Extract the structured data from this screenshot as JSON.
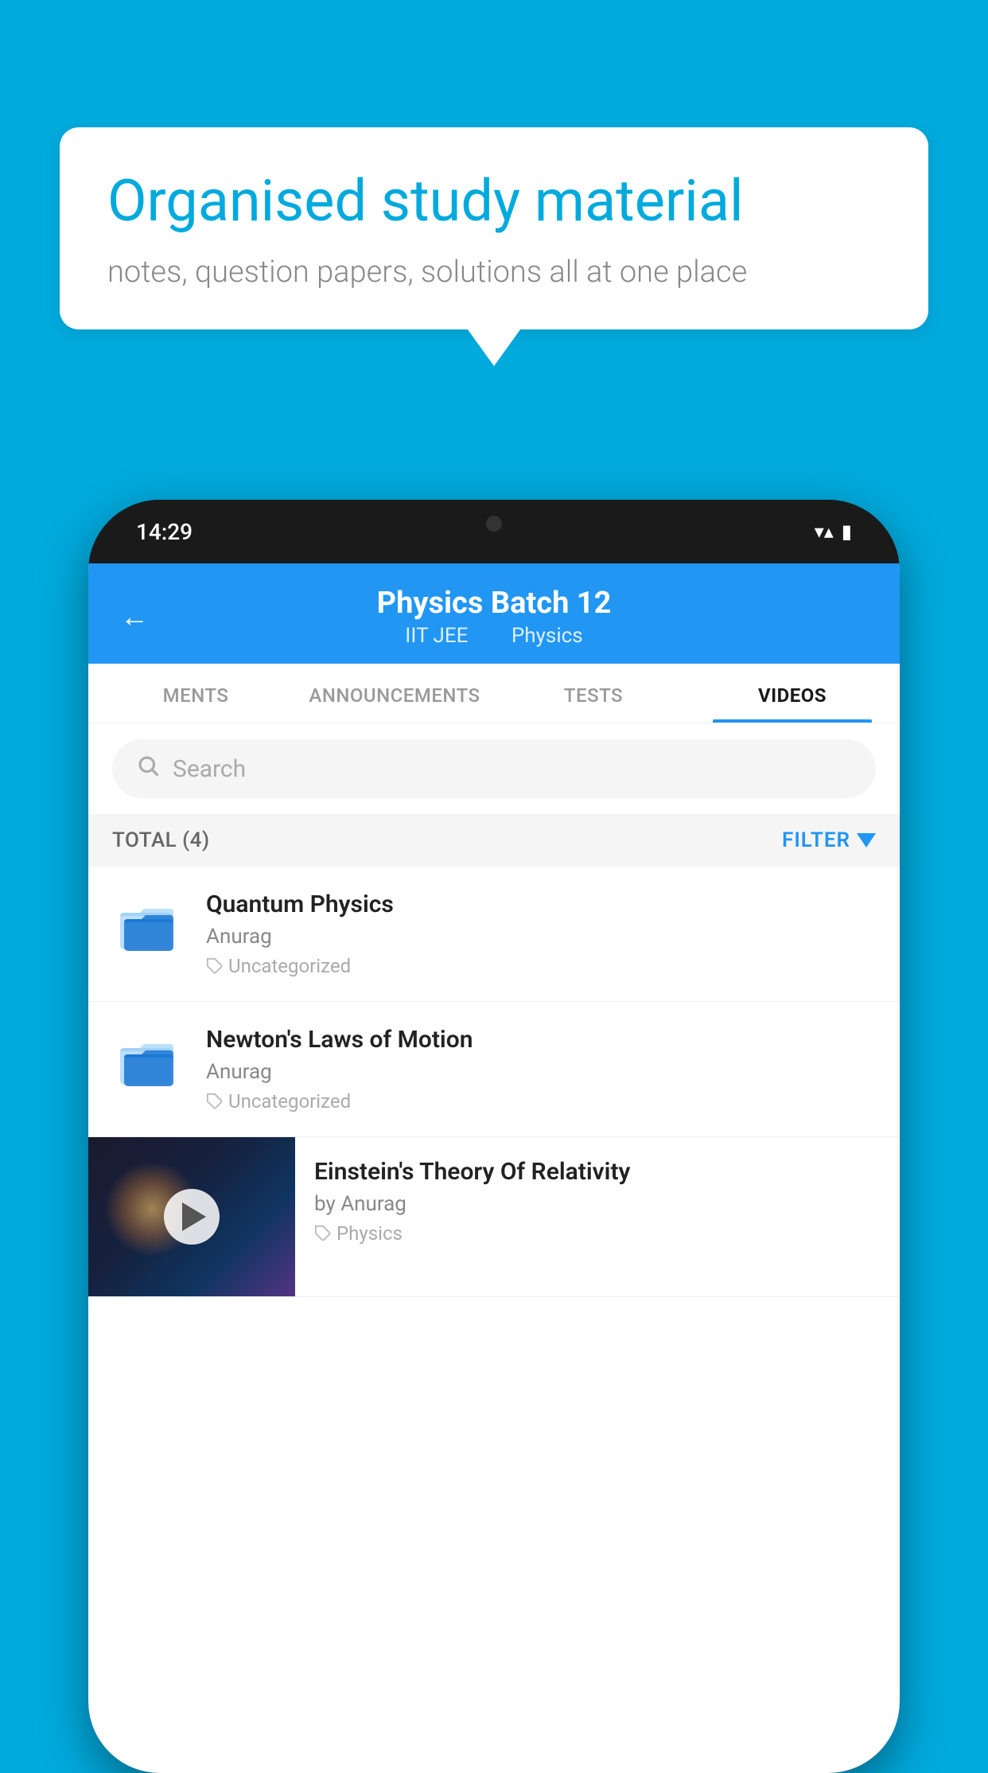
{
  "background_color": "#00AADD",
  "speech_bubble": {
    "headline": "Organised study material",
    "subtext": "notes, question papers, solutions all at one place"
  },
  "phone": {
    "status_bar": {
      "time": "14:29",
      "wifi": "▼",
      "signal": "▲",
      "battery": "▮"
    },
    "header": {
      "back_label": "←",
      "title": "Physics Batch 12",
      "subtitle_part1": "IIT JEE",
      "subtitle_part2": "Physics"
    },
    "tabs": [
      {
        "label": "MENTS",
        "active": false
      },
      {
        "label": "ANNOUNCEMENTS",
        "active": false
      },
      {
        "label": "TESTS",
        "active": false
      },
      {
        "label": "VIDEOS",
        "active": true
      }
    ],
    "search": {
      "placeholder": "Search"
    },
    "filter_row": {
      "total_label": "TOTAL (4)",
      "filter_label": "FILTER"
    },
    "video_items": [
      {
        "type": "folder",
        "title": "Quantum Physics",
        "author": "Anurag",
        "tag": "Uncategorized"
      },
      {
        "type": "folder",
        "title": "Newton's Laws of Motion",
        "author": "Anurag",
        "tag": "Uncategorized"
      },
      {
        "type": "thumbnail",
        "title": "Einstein's Theory Of Relativity",
        "author": "by Anurag",
        "tag": "Physics"
      }
    ]
  }
}
